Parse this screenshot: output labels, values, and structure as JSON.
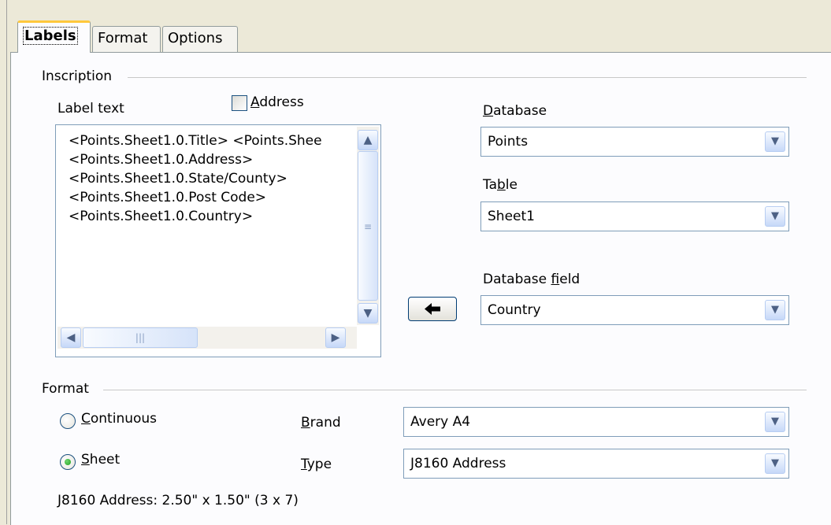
{
  "tabs": [
    {
      "label": "Labels",
      "active": true
    },
    {
      "label": "Format",
      "active": false
    },
    {
      "label": "Options",
      "active": false
    }
  ],
  "inscription": {
    "section_title": "Inscription",
    "label_text_caption": "Label text",
    "address_checkbox": {
      "label": "Address",
      "checked": false
    },
    "label_text_lines": [
      "<Points.Sheet1.0.Title> <Points.Shee",
      "<Points.Sheet1.0.Address>",
      "<Points.Sheet1.0.State/County>",
      "<Points.Sheet1.0.Post Code>",
      "<Points.Sheet1.0.Country>"
    ],
    "database": {
      "label": "Database",
      "value": "Points"
    },
    "table": {
      "label": "Table",
      "value": "Sheet1"
    },
    "database_field": {
      "label": "Database field",
      "value": "Country"
    },
    "insert_button_icon": "left-arrow-icon"
  },
  "format": {
    "section_title": "Format",
    "continuous": {
      "label": "Continuous",
      "selected": false
    },
    "sheet": {
      "label": "Sheet",
      "selected": true
    },
    "brand": {
      "label": "Brand",
      "value": "Avery A4"
    },
    "type": {
      "label": "Type",
      "value": "J8160 Address"
    },
    "size_info": "J8160 Address: 2.50\" x 1.50\" (3 x 7)"
  },
  "colors": {
    "dialog_bg": "#ece9d8",
    "panel_bg": "#fcfcfe",
    "active_tab_accent": "#ffc83c",
    "control_border": "#7f9db9"
  }
}
